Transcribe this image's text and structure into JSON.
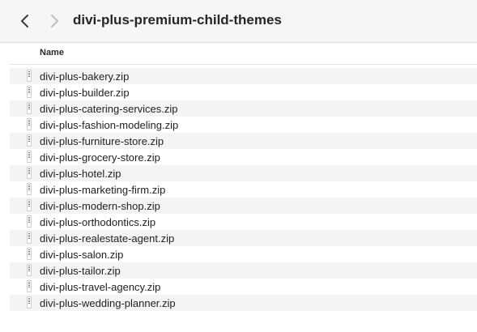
{
  "window": {
    "title": "divi-plus-premium-child-themes"
  },
  "toolbar": {
    "back_icon": "chevron-left-icon",
    "forward_icon": "chevron-right-icon"
  },
  "columns": {
    "name_header": "Name"
  },
  "files": [
    {
      "name": "divi-plus-bakery.zip",
      "icon": "zip-file-icon"
    },
    {
      "name": "divi-plus-builder.zip",
      "icon": "zip-file-icon"
    },
    {
      "name": "divi-plus-catering-services.zip",
      "icon": "zip-file-icon"
    },
    {
      "name": "divi-plus-fashion-modeling.zip",
      "icon": "zip-file-icon"
    },
    {
      "name": "divi-plus-furniture-store.zip",
      "icon": "zip-file-icon"
    },
    {
      "name": "divi-plus-grocery-store.zip",
      "icon": "zip-file-icon"
    },
    {
      "name": "divi-plus-hotel.zip",
      "icon": "zip-file-icon"
    },
    {
      "name": "divi-plus-marketing-firm.zip",
      "icon": "zip-file-icon"
    },
    {
      "name": "divi-plus-modern-shop.zip",
      "icon": "zip-file-icon"
    },
    {
      "name": "divi-plus-orthodontics.zip",
      "icon": "zip-file-icon"
    },
    {
      "name": "divi-plus-realestate-agent.zip",
      "icon": "zip-file-icon"
    },
    {
      "name": "divi-plus-salon.zip",
      "icon": "zip-file-icon"
    },
    {
      "name": "divi-plus-tailor.zip",
      "icon": "zip-file-icon"
    },
    {
      "name": "divi-plus-travel-agency.zip",
      "icon": "zip-file-icon"
    },
    {
      "name": "divi-plus-wedding-planner.zip",
      "icon": "zip-file-icon"
    }
  ],
  "colors": {
    "toolbar_bg": "#f6f6f6",
    "row_alt": "#f4f4f4",
    "text": "#1f1f1f"
  }
}
